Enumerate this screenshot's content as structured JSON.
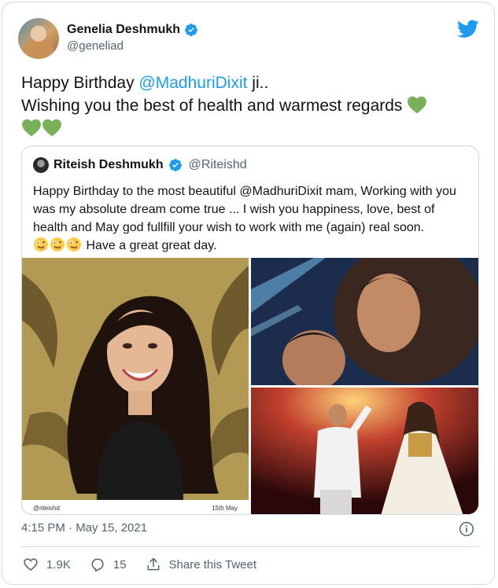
{
  "tweet": {
    "author_name": "Genelia Deshmukh",
    "author_handle": "@geneliad",
    "text_line1_prefix": "Happy Birthday ",
    "text_line1_mention": "@MadhuriDixit",
    "text_line1_suffix": " ji..",
    "text_line2": "Wishing you the best of health and warmest regards",
    "timestamp": "4:15 PM · May 15, 2021",
    "likes": "1.9K",
    "replies": "15",
    "share_label": "Share this Tweet"
  },
  "quote": {
    "author_name": "Riteish Deshmukh",
    "author_handle": "@Riteishd",
    "text": "Happy Birthday to the most beautiful @MadhuriDixit mam, Working with you was my absolute dream come true ... I wish you happiness, love, best of health and May god fullfill your wish to work with me (again) real soon.",
    "text_end": " Have a great great day.",
    "watermark_handle": "@riteishd",
    "watermark_date": "15th May"
  },
  "icons": {
    "verified": "verified-badge-icon",
    "twitter": "twitter-bird-icon",
    "heart_green": "green-heart-icon",
    "emoji": "zany-face-icon",
    "info": "info-icon",
    "like": "heart-icon",
    "reply": "reply-icon",
    "share": "share-icon"
  },
  "colors": {
    "accent": "#1d9bf0",
    "text": "#0f1419",
    "secondary": "#536471",
    "border": "#cfd9de",
    "green_heart": "#78b159"
  }
}
